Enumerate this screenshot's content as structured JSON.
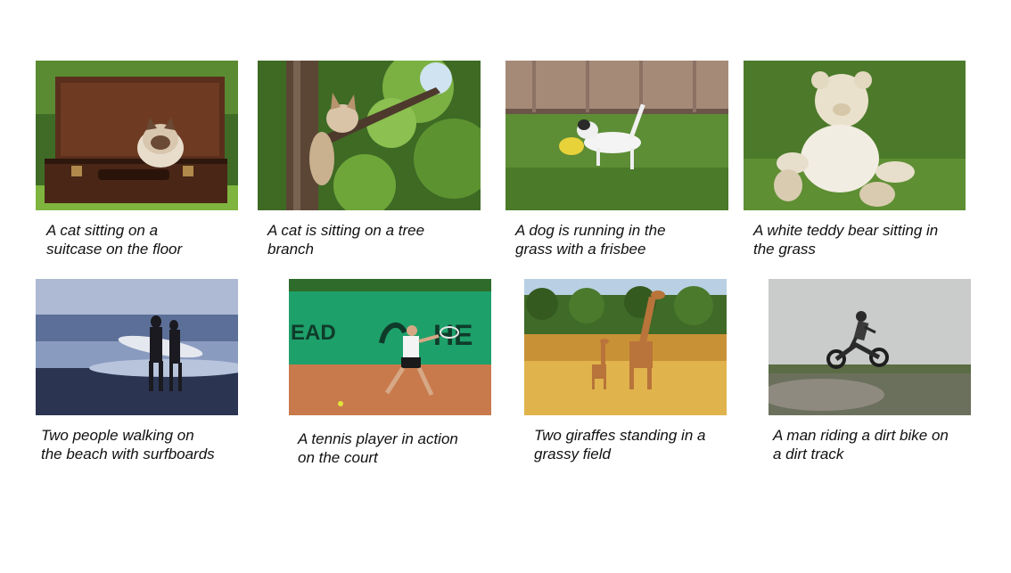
{
  "images": [
    {
      "name": "cat-suitcase-photo",
      "caption": "A cat sitting on a\nsuitcase on the floor"
    },
    {
      "name": "cat-tree-photo",
      "caption": "A cat is sitting on a tree\nbranch"
    },
    {
      "name": "dog-frisbee-photo",
      "caption": "A dog is running in the\ngrass with a frisbee"
    },
    {
      "name": "teddy-bear-photo",
      "caption": "A white teddy bear sitting in\nthe grass"
    },
    {
      "name": "surfers-beach-photo",
      "caption": "Two people walking on\nthe beach with surfboards"
    },
    {
      "name": "tennis-player-photo",
      "caption": "A tennis player in action\non the court"
    },
    {
      "name": "giraffes-photo",
      "caption": "Two giraffes standing in a\ngrassy field"
    },
    {
      "name": "dirt-bike-photo",
      "caption": "A man riding a dirt bike on\na dirt track"
    }
  ],
  "tennis_banner": {
    "left_text": "EAD",
    "right_text": "HE"
  }
}
